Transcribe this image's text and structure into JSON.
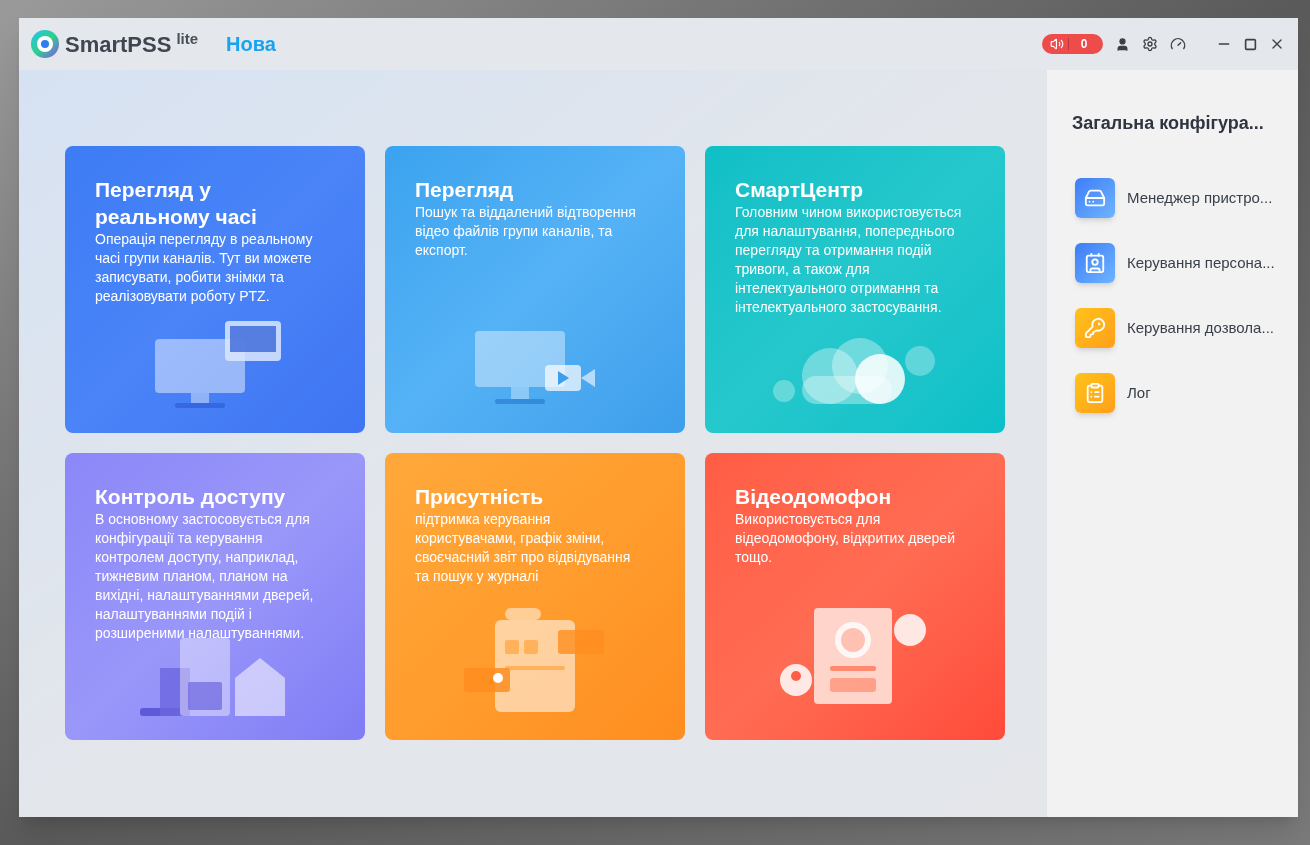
{
  "window": {
    "app_name": "SmartPSS",
    "app_edition": "lite",
    "tabs": [
      {
        "label": "Нова",
        "selected": true
      }
    ],
    "alarm": {
      "count": "0"
    }
  },
  "modules": [
    {
      "kind": "live",
      "title": "Перегляд у реальному часі",
      "description": "Операція перегляду в реальному часі групи каналів. Тут ви можете записувати, робити знімки та реалізовувати роботу PTZ."
    },
    {
      "kind": "playback",
      "title": "Перегляд",
      "description": "Пошук та віддалений відтворення відео файлів групи каналів, та експорт."
    },
    {
      "kind": "smart",
      "title": "СмартЦентр",
      "description": "Головним чином використовується для налаштування, попереднього перегляду та отримання подій тривоги, а також для інтелектуального отримання та інтелектуального застосування."
    },
    {
      "kind": "access",
      "title": "Контроль доступу",
      "description": "В основному застосовується для конфігурації та керування контролем доступу, наприклад, тижневим планом, планом на вихідні, налаштуваннями дверей, налаштуваннями подій і розширеними налаштуваннями."
    },
    {
      "kind": "attendance",
      "title": "Присутність",
      "description": "підтримка керування користувачами, графік зміни, своєчасний звіт про відвідування та пошук у журналі"
    },
    {
      "kind": "intercom",
      "title": "Відеодомофон",
      "description": "Використовується для відеодомофону, відкритих дверей тощо."
    }
  ],
  "sidebar": {
    "title": "Загальна конфігура...",
    "items": [
      {
        "kind": "device",
        "label": "Менеджер пристро..."
      },
      {
        "kind": "person",
        "label": "Керування персона..."
      },
      {
        "kind": "permission",
        "label": "Керування дозвола..."
      },
      {
        "kind": "log",
        "label": "Лог"
      }
    ]
  }
}
